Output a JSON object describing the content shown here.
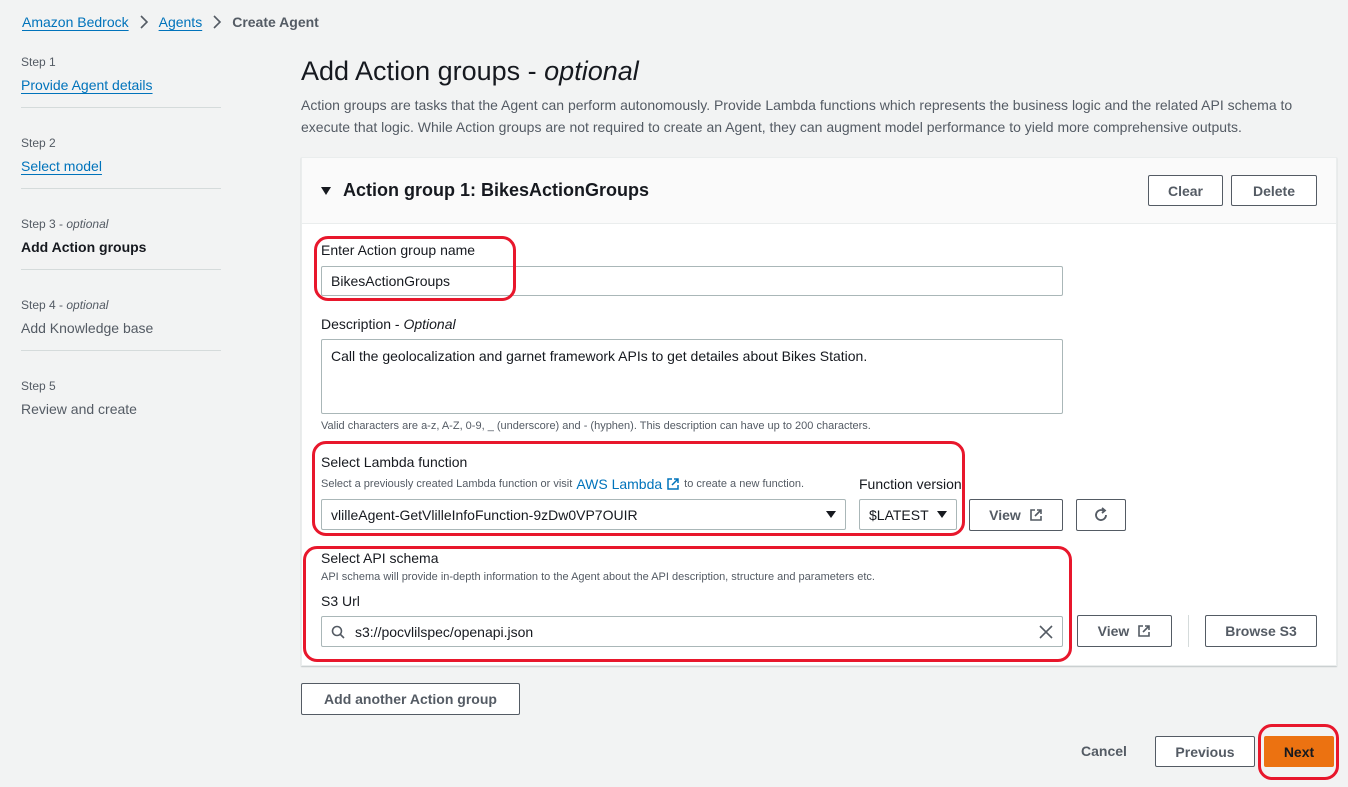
{
  "breadcrumb": {
    "items": [
      "Amazon Bedrock",
      "Agents"
    ],
    "current": "Create Agent",
    "separator": ">"
  },
  "steps": [
    {
      "step": "Step 1",
      "optional": "",
      "label": "Provide Agent details"
    },
    {
      "step": "Step 2",
      "optional": "",
      "label": "Select model"
    },
    {
      "step": "Step 3",
      "optional": "optional",
      "label": "Add Action groups"
    },
    {
      "step": "Step 4",
      "optional": "optional",
      "label": "Add Knowledge base"
    },
    {
      "step": "Step 5",
      "optional": "",
      "label": "Review and create"
    }
  ],
  "step_dash": " - ",
  "page": {
    "title": "Add Action groups - ",
    "title_optional": "optional",
    "description": "Action groups are tasks that the Agent can perform autonomously. Provide Lambda functions which represents the business logic and the related API schema to execute that logic. While Action groups are not required to create an Agent, they can augment model performance to yield more comprehensive outputs."
  },
  "action_group": {
    "title": "Action group 1: BikesActionGroups",
    "clear_label": "Clear",
    "delete_label": "Delete",
    "name_label": "Enter Action group name",
    "name_value": "BikesActionGroups",
    "description_label": "Description - ",
    "description_optional": "Optional",
    "description_value": "Call the geolocalization and garnet framework APIs to get detailes about Bikes Station.",
    "description_hint": "Valid characters are a-z, A-Z, 0-9, _ (underscore) and - (hyphen). This description can have up to 200 characters.",
    "lambda_label": "Select Lambda function",
    "lambda_hint_pre": "Select a previously created Lambda function or visit",
    "lambda_hint_link": "AWS Lambda",
    "lambda_hint_post": "to create a new function.",
    "lambda_value": "vlilleAgent-GetVlilleInfoFunction-9zDw0VP7OUIR",
    "version_label": "Function version",
    "version_value": "$LATEST",
    "view_label": "View",
    "schema_label": "Select API schema",
    "schema_hint": "API schema will provide in-depth information to the Agent about the API description, structure and parameters etc.",
    "s3_label": "S3 Url",
    "s3_value": "s3://pocvlilspec/openapi.json",
    "view_s3_label": "View",
    "browse_s3_label": "Browse S3"
  },
  "add_group_label": "Add another Action group",
  "footer": {
    "cancel_label": "Cancel",
    "previous_label": "Previous",
    "next_label": "Next"
  },
  "colors": {
    "link": "#0073bb",
    "primary": "#ec7211",
    "highlight": "#e8172c",
    "background": "#f2f3f3"
  },
  "icons": [
    "chevron-right-icon",
    "caret-down-icon",
    "external-link-icon",
    "refresh-icon",
    "search-icon",
    "clear-x-icon"
  ]
}
